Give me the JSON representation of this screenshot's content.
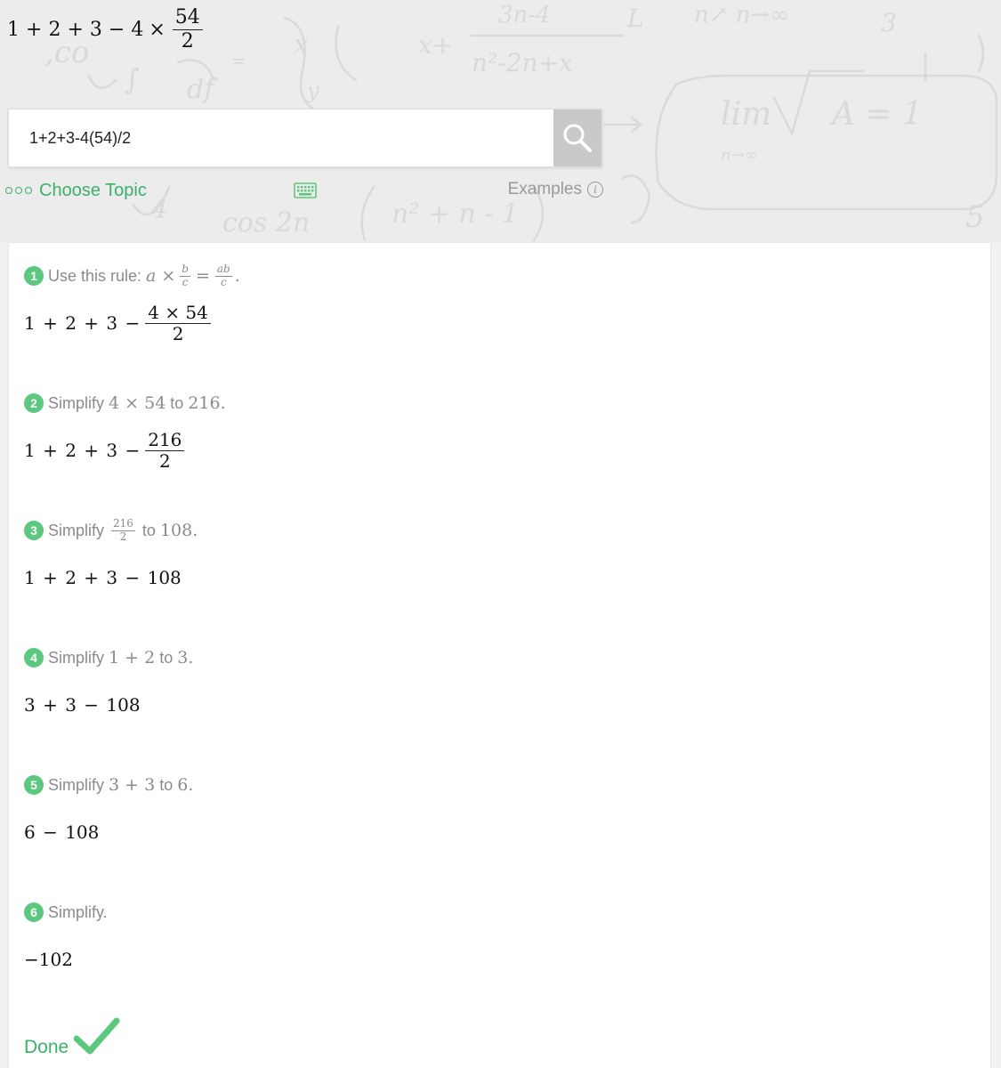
{
  "headline": {
    "a": "1",
    "b": "2",
    "c": "3",
    "d": "4",
    "num": "54",
    "den": "2"
  },
  "search": {
    "value": "1+2+3-4(54)/2",
    "button_icon": "search-icon"
  },
  "toolbar": {
    "choose_topic": "Choose Topic",
    "examples": "Examples",
    "keyboard_icon": "keyboard-icon",
    "info_icon": "info-icon"
  },
  "steps": [
    {
      "n": "1",
      "label": "Use this rule:",
      "rule": {
        "lhs": "a",
        "num": "b",
        "den": "c",
        "rnum": "ab",
        "rden": "c"
      },
      "expr": {
        "prefix": "1 + 2 + 3 −",
        "num": "4 × 54",
        "den": "2"
      }
    },
    {
      "n": "2",
      "label": "Simplify",
      "from": "4 × 54",
      "to_word": "to",
      "to": "216",
      "expr": {
        "prefix": "1 + 2 + 3 −",
        "num": "216",
        "den": "2"
      }
    },
    {
      "n": "3",
      "label": "Simplify",
      "from_num": "216",
      "from_den": "2",
      "to_word": "to",
      "to": "108",
      "expr": "1 + 2 + 3 − 108"
    },
    {
      "n": "4",
      "label": "Simplify",
      "from": "1 + 2",
      "to_word": "to",
      "to": "3",
      "expr": "3 + 3 − 108"
    },
    {
      "n": "5",
      "label": "Simplify",
      "from": "3 + 3",
      "to_word": "to",
      "to": "6",
      "expr": "6 − 108"
    },
    {
      "n": "6",
      "label": "Simplify.",
      "expr": "−102"
    }
  ],
  "done": {
    "label": "Done",
    "icon": "checkmark-icon"
  },
  "colors": {
    "accent": "#3bb16a",
    "badge": "#5cc77e",
    "muted": "#8b8b8b"
  }
}
